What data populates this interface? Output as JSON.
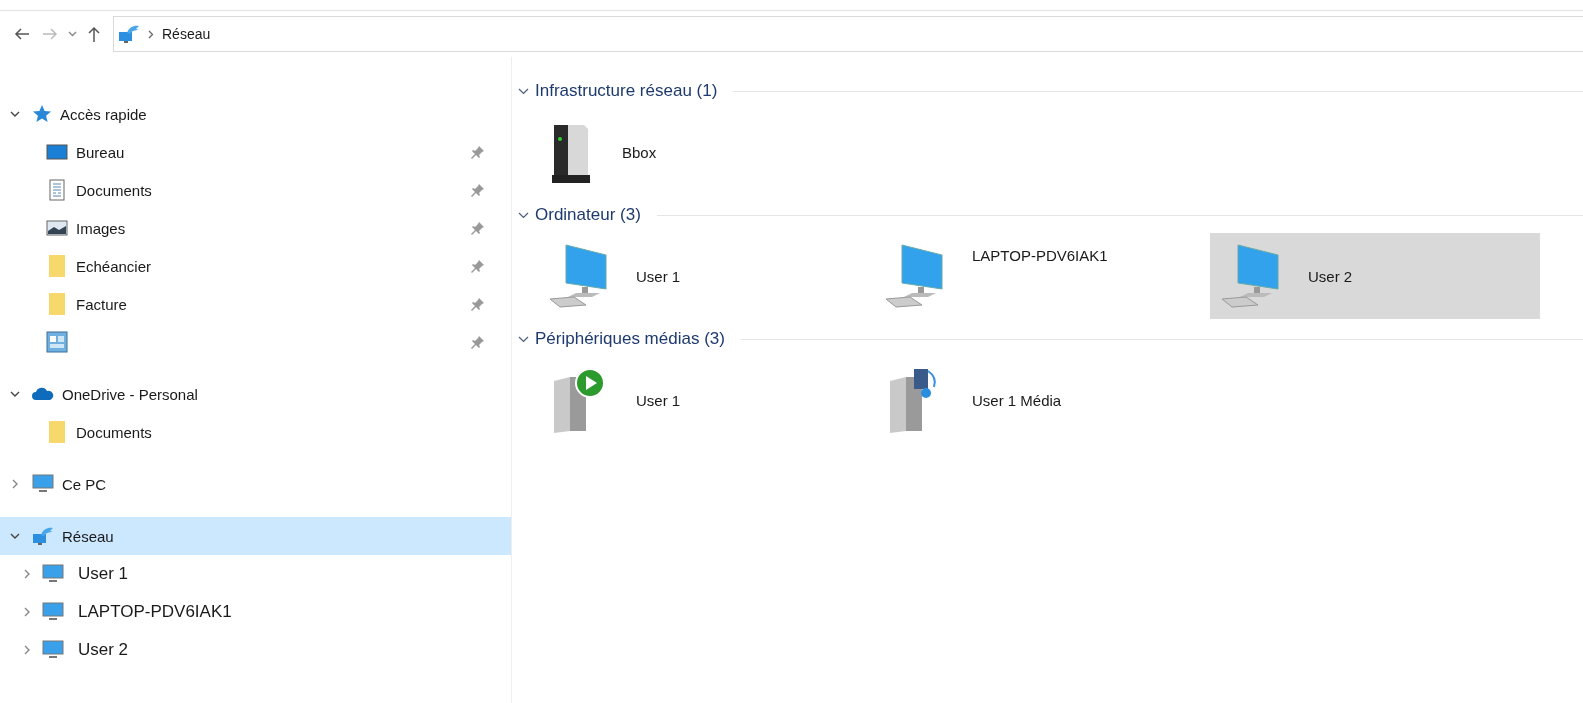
{
  "address_bar": {
    "location": "Réseau"
  },
  "sidebar": [
    {
      "label": "Accès rapide",
      "kind": "star",
      "expanded": true,
      "selected": false,
      "children": [
        {
          "label": "Bureau",
          "kind": "desktop",
          "pinned": true
        },
        {
          "label": "Documents",
          "kind": "document",
          "pinned": true
        },
        {
          "label": "Images",
          "kind": "image",
          "pinned": true
        },
        {
          "label": "Echéancier",
          "kind": "folder",
          "pinned": true
        },
        {
          "label": "Facture",
          "kind": "folder",
          "pinned": true
        },
        {
          "kind": "panel",
          "pinned": true
        }
      ]
    },
    {
      "label": "OneDrive - Personal",
      "kind": "cloud",
      "expanded": true,
      "selected": false,
      "children": [
        {
          "label": "Documents",
          "kind": "folder",
          "pinned": false
        }
      ]
    },
    {
      "label": "Ce PC",
      "kind": "pc",
      "expanded": false,
      "selected": false
    },
    {
      "label": "Réseau",
      "kind": "network",
      "expanded": true,
      "selected": true,
      "children": [
        {
          "label": "User 1",
          "kind": "pc",
          "expanded": false
        },
        {
          "label": "LAPTOP-PDV6IAK1",
          "kind": "pc",
          "expanded": false
        },
        {
          "label": "User 2",
          "kind": "pc",
          "expanded": false
        }
      ]
    }
  ],
  "groups": [
    {
      "title": "Infrastructure réseau (1)",
      "expanded": true,
      "items": [
        {
          "label": "Bbox",
          "kind": "router",
          "selected": false
        }
      ]
    },
    {
      "title": "Ordinateur (3)",
      "expanded": true,
      "items": [
        {
          "label": "User 1",
          "kind": "computer",
          "selected": false
        },
        {
          "label": "LAPTOP-PDV6IAK1",
          "kind": "computer",
          "selected": false
        },
        {
          "label": "User 2",
          "kind": "computer",
          "selected": true
        }
      ]
    },
    {
      "title": "Périphériques médias (3)",
      "expanded": true,
      "items": [
        {
          "label": "User 1",
          "kind": "media-player",
          "selected": false
        },
        {
          "label": "User 1 Média",
          "kind": "media-device",
          "selected": false
        }
      ]
    }
  ]
}
